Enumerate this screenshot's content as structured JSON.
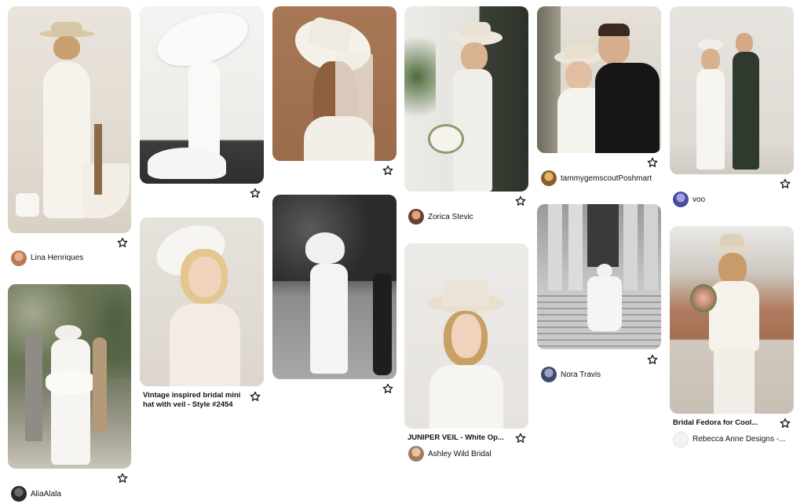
{
  "pins": {
    "p1": {
      "author": "Lina Henriques",
      "image_alt": "bride in white satin gown with boater hat seated on stool"
    },
    "p2": {
      "author": "AliaAlala",
      "image_alt": "bride with large white bow on back of dress"
    },
    "p3": {
      "image_alt": "bride hiding under oversized white hat"
    },
    "p4": {
      "title": "Vintage inspired bridal mini hat with veil - Style #2454",
      "image_alt": "bride wearing white mini hat with netted veil"
    },
    "p5": {
      "image_alt": "bride in wide brim hat with long veil"
    },
    "p6": {
      "image_alt": "black and white photo of bride in hat holding hands"
    },
    "p7": {
      "author": "Zorica Stevic",
      "image_alt": "bride in hat holding bouquet by iron gate"
    },
    "p8": {
      "title": "JUNIPER VEIL - White Op...",
      "author": "Ashley Wild Bridal",
      "image_alt": "bride wearing cream fedora with veil"
    },
    "p9": {
      "author": "tammygemscoutPoshmart",
      "image_alt": "bride in hat with groom in tuxedo"
    },
    "p10": {
      "author": "Nora Travis",
      "image_alt": "bride in white suit sitting on steps"
    },
    "p11": {
      "author": "voo",
      "image_alt": "couple posing against stone wall"
    },
    "p12": {
      "title": "Bridal Fedora for Cool...",
      "author": "Rebecca Anne Designs -...",
      "image_alt": "bride in white pantsuit and fedora holding bouquet"
    }
  },
  "icons": {
    "save": "star-outline-icon"
  }
}
